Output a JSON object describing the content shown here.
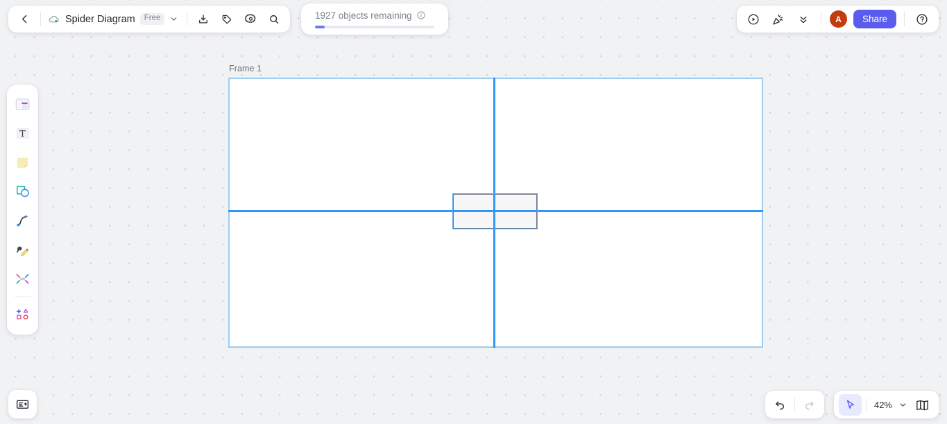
{
  "header": {
    "back_icon": "chevron-left-icon",
    "cloud_icon": "cloud-synced-icon",
    "doc_title": "Spider Diagram",
    "plan_badge": "Free",
    "title_chevron_icon": "chevron-down-icon",
    "actions": [
      {
        "name": "download-icon",
        "label": "Download"
      },
      {
        "name": "tag-icon",
        "label": "Tags"
      },
      {
        "name": "gear-icon",
        "label": "Settings"
      },
      {
        "name": "search-icon",
        "label": "Search"
      }
    ]
  },
  "objects_panel": {
    "text": "1927 objects remaining",
    "info_icon": "info-circle-icon",
    "progress_percent": 8
  },
  "header_right": {
    "present_icon": "play-circle-icon",
    "celebrate_icon": "party-popper-icon",
    "collapse_icon": "double-chevron-down-icon",
    "avatar_initial": "A",
    "avatar_color": "#c23c10",
    "share_label": "Share",
    "share_color": "#5a5cf0",
    "help_icon": "help-circle-icon"
  },
  "tool_rail": {
    "items": [
      {
        "name": "template-icon",
        "label": "Templates"
      },
      {
        "name": "text-icon",
        "label": "Text"
      },
      {
        "name": "sticky-note-icon",
        "label": "Sticky note"
      },
      {
        "name": "shapes-icon",
        "label": "Shapes"
      },
      {
        "name": "connector-icon",
        "label": "Connection line"
      },
      {
        "name": "pen-icon",
        "label": "Pen"
      },
      {
        "name": "frame-icon",
        "label": "Frame"
      },
      {
        "name": "more-shapes-icon",
        "label": "More apps"
      }
    ]
  },
  "canvas": {
    "frame_label": "Frame 1",
    "frame_border_color": "#9ecbf0",
    "guide_color": "#2f97f7",
    "selected_shape": {
      "name": "selected-rectangle",
      "fill": "#f7f7f8",
      "border": "#6f7b8a"
    }
  },
  "bottom_left": {
    "notes_icon": "presentation-notes-icon"
  },
  "bottom_right": {
    "undo_icon": "undo-arrow-icon",
    "redo_icon": "redo-arrow-icon",
    "cursor_icon": "cursor-select-icon",
    "zoom_value": "42%",
    "zoom_chevron_icon": "chevron-down-icon",
    "minimap_icon": "minimap-book-icon"
  }
}
